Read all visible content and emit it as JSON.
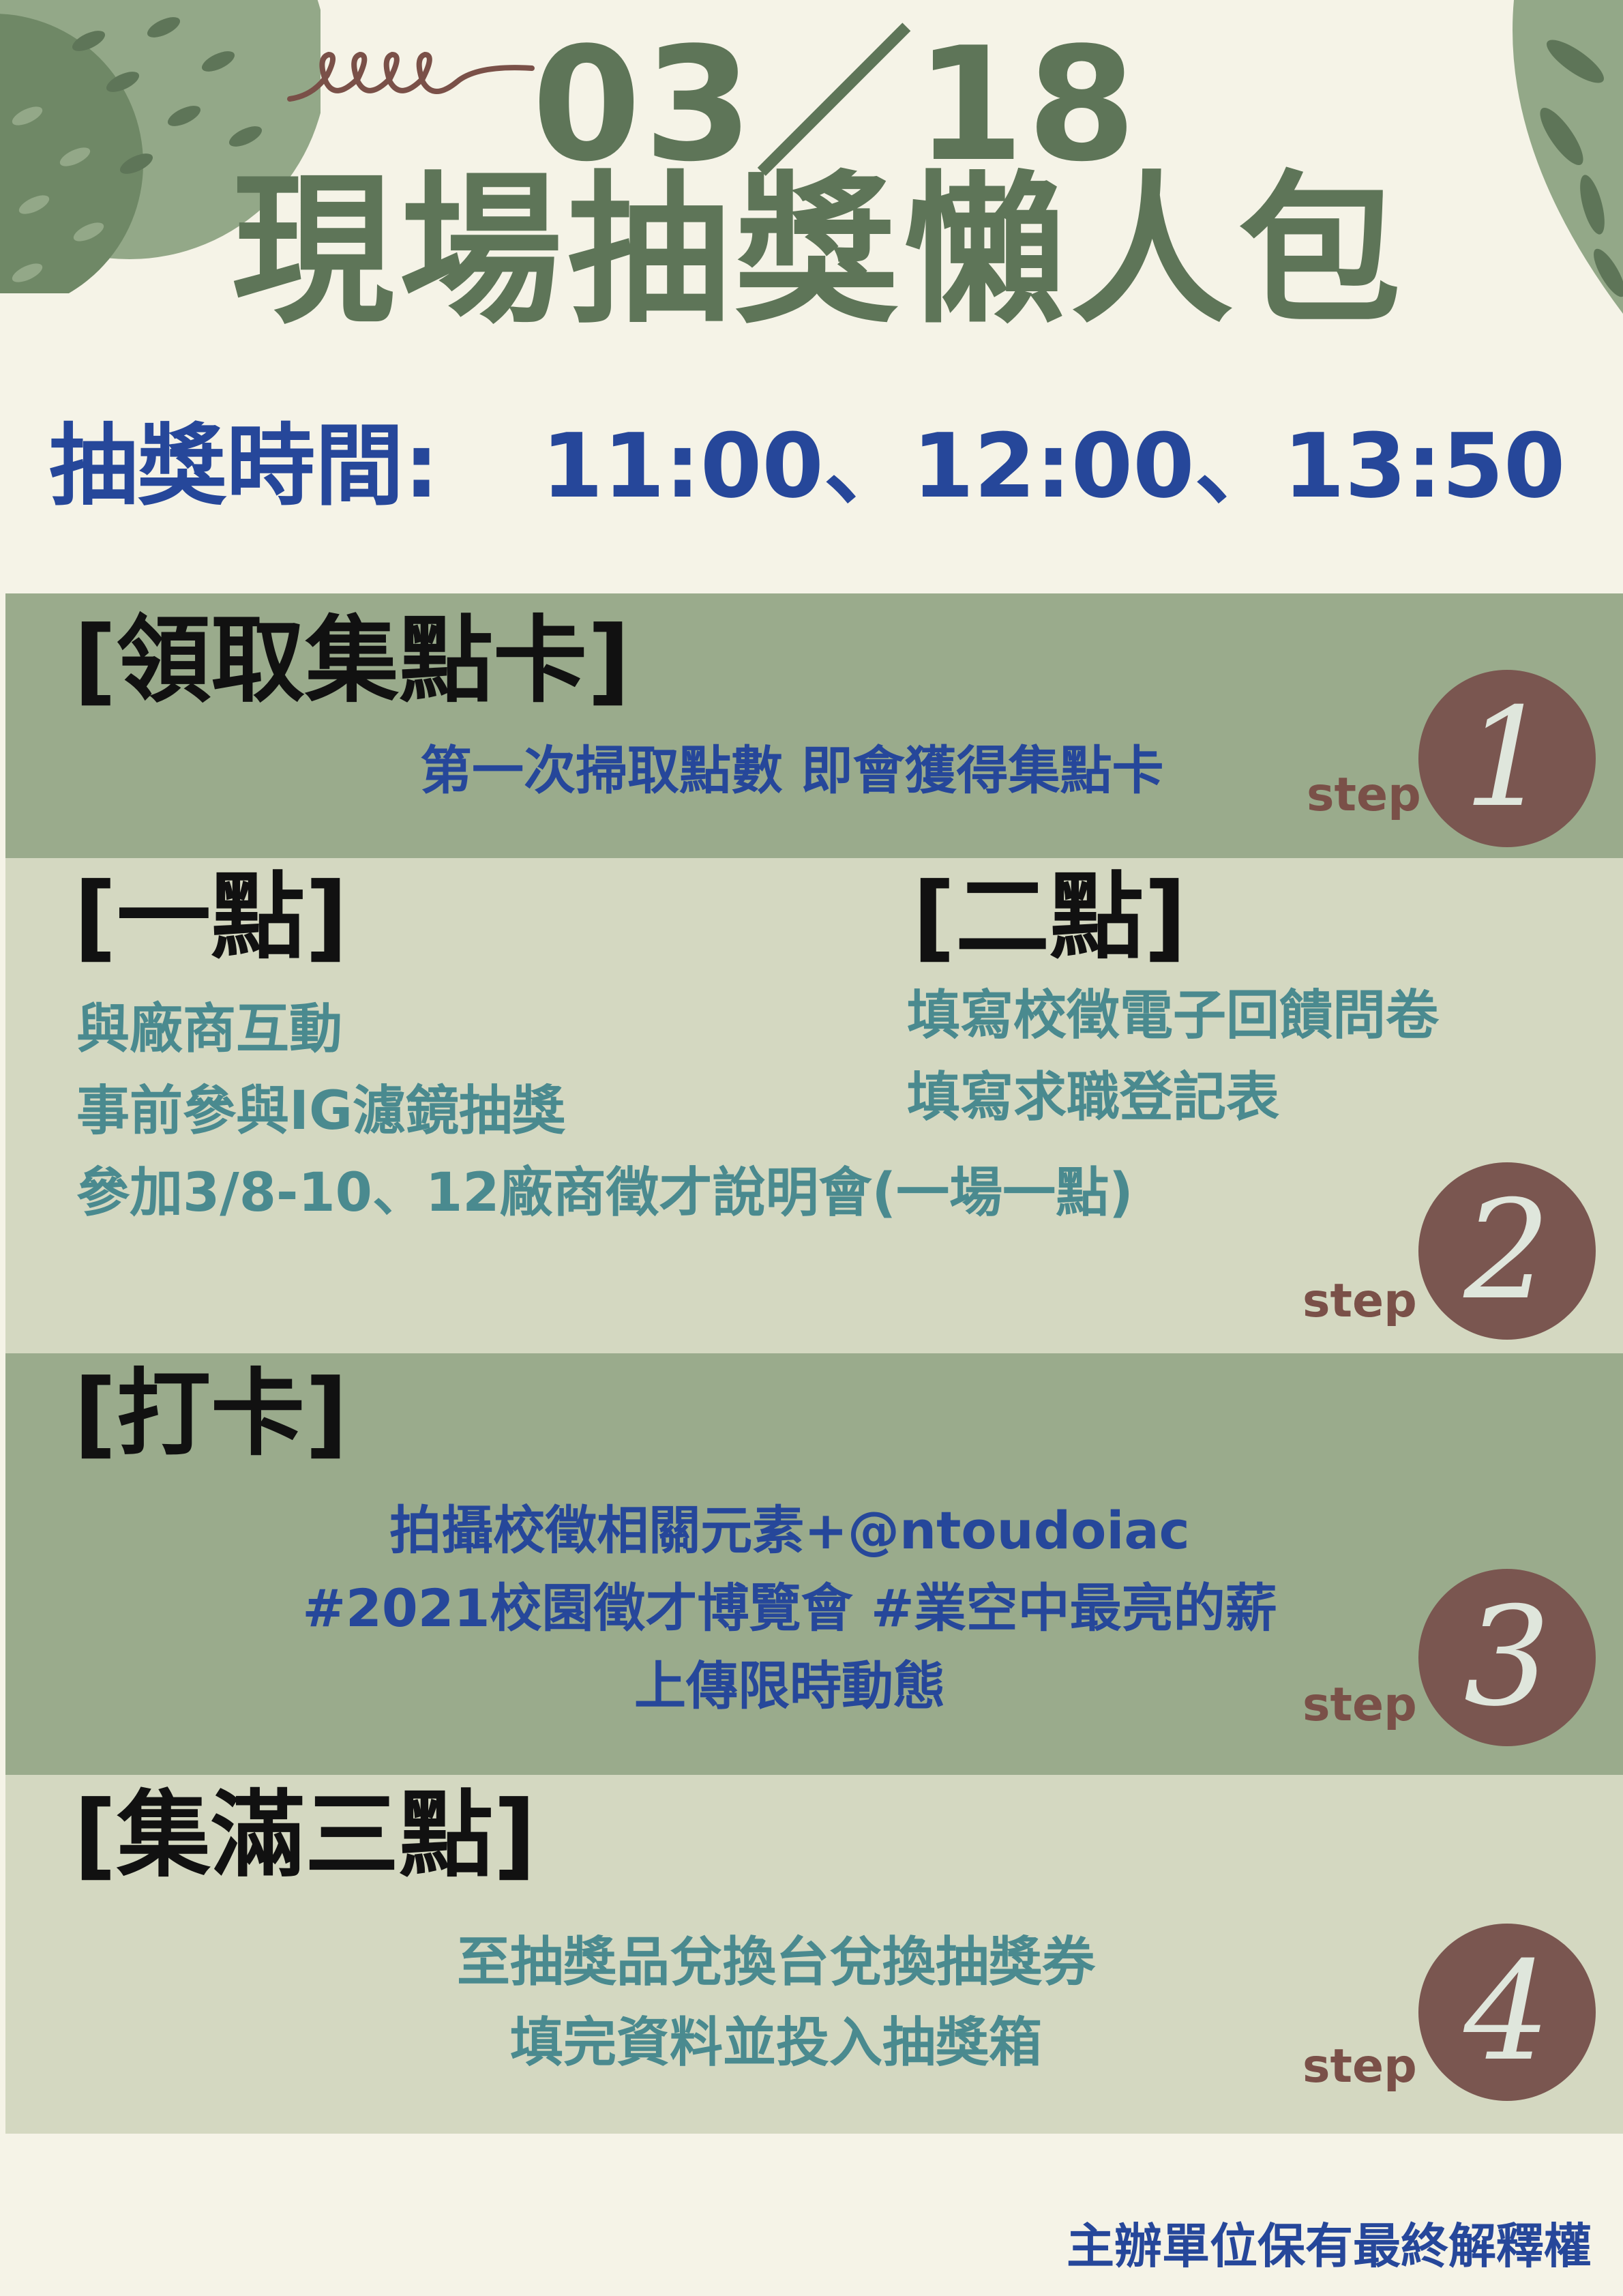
{
  "header": {
    "date": "03／18",
    "title": "現場抽獎懶人包"
  },
  "draw_time": {
    "label": "抽獎時間:",
    "times": "11:00、12:00、13:50"
  },
  "step1": {
    "heading": "[領取集點卡]",
    "text": "第一次掃取點數  即會獲得集點卡",
    "step_word": "step",
    "number": "1"
  },
  "step2": {
    "heading_left": "[一點]",
    "heading_right": "[二點]",
    "left_items": [
      "與廠商互動",
      "事前參與IG濾鏡抽獎",
      "參加3/8-10、12廠商徵才說明會(一場一點)"
    ],
    "right_items": [
      "填寫校徵電子回饋問卷",
      "填寫求職登記表"
    ],
    "step_word": "step",
    "number": "2"
  },
  "step3": {
    "heading": "[打卡]",
    "lines": [
      "拍攝校徵相關元素+@ntoudoiac",
      "#2021校園徵才博覽會  #業空中最亮的薪",
      "上傳限時動態"
    ],
    "step_word": "step",
    "number": "3"
  },
  "step4": {
    "heading": "[集滿三點]",
    "lines": [
      "至抽獎品兌換台兌換抽獎券",
      "填完資料並投入抽獎箱"
    ],
    "step_word": "step",
    "number": "4"
  },
  "footer": {
    "text": "主辦單位保有最終解釋權"
  },
  "colors": {
    "background": "#f5f3e7",
    "title_green": "#5e7558",
    "navy": "#26479a",
    "teal": "#4a8a8f",
    "band_dark": "#9aab8c",
    "band_light": "#d4d8c1",
    "step_circle": "#7a5650"
  }
}
